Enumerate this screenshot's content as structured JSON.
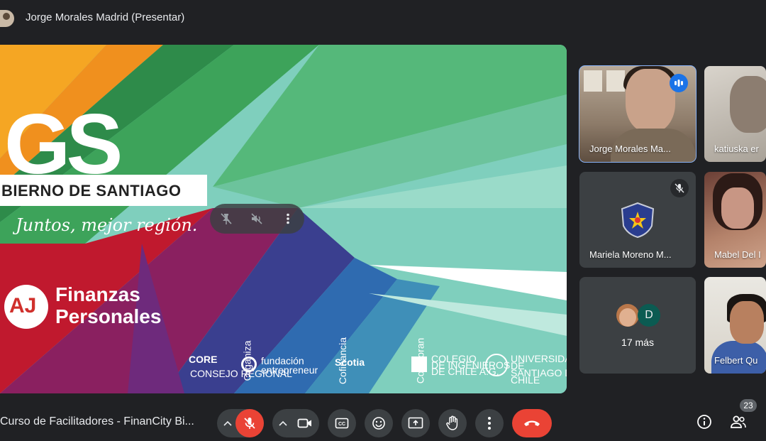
{
  "header": {
    "presenter_label": "Jorge Morales Madrid (Presentar)"
  },
  "slide": {
    "logo_text": "GS",
    "gov_text": "BIERNO DE SANTIAGO",
    "slogan": "Juntos, mejor región.",
    "aj_mark": "AJ",
    "finanzas_line1": "Finanzas",
    "finanzas_line2": "Personales",
    "sponsors": {
      "core": "CORE",
      "core_sub": "CONSEJO REGIONAL",
      "organiza": "Organiza",
      "fundacion_line1": "fundación",
      "fundacion_line2": "entrepreneur",
      "cofinancia": "Cofinancia",
      "scotia": "Scotia",
      "colaboran": "Colaboran",
      "colegio_line1": "COLEGIO",
      "colegio_line2": "DE INGENIEROS",
      "colegio_line3": "DE CHILE A.G.",
      "usach_line1": "UNIVERSIDAD DE",
      "usach_line2": "SANTIAGO DE CHILE"
    }
  },
  "participants": [
    {
      "name": "Jorge Morales Ma...",
      "speaking": true
    },
    {
      "name": "katiuska er"
    },
    {
      "name": "Mariela Moreno M...",
      "muted": true
    },
    {
      "name": "Mabel Del I"
    },
    {
      "name": "Felbert Qu"
    }
  ],
  "more_tile": {
    "avatar_letter": "D",
    "label": "17 más"
  },
  "footer": {
    "meeting_title": "Curso de Facilitadores - FinanCity Bi...",
    "participant_count": "23"
  },
  "colors": {
    "background": "#202124",
    "control": "#3c4043",
    "danger": "#ea4335",
    "speaking": "#1a73e8",
    "active_outline": "#8ab4f8"
  },
  "icons": [
    "mic-off-icon",
    "videocam-icon",
    "captions-icon",
    "emoji-icon",
    "present-screen-icon",
    "raise-hand-icon",
    "more-vert-icon",
    "call-end-icon",
    "info-icon",
    "people-icon",
    "pin-off-icon",
    "volume-off-icon",
    "zoom-icon",
    "audio-level-icon"
  ]
}
